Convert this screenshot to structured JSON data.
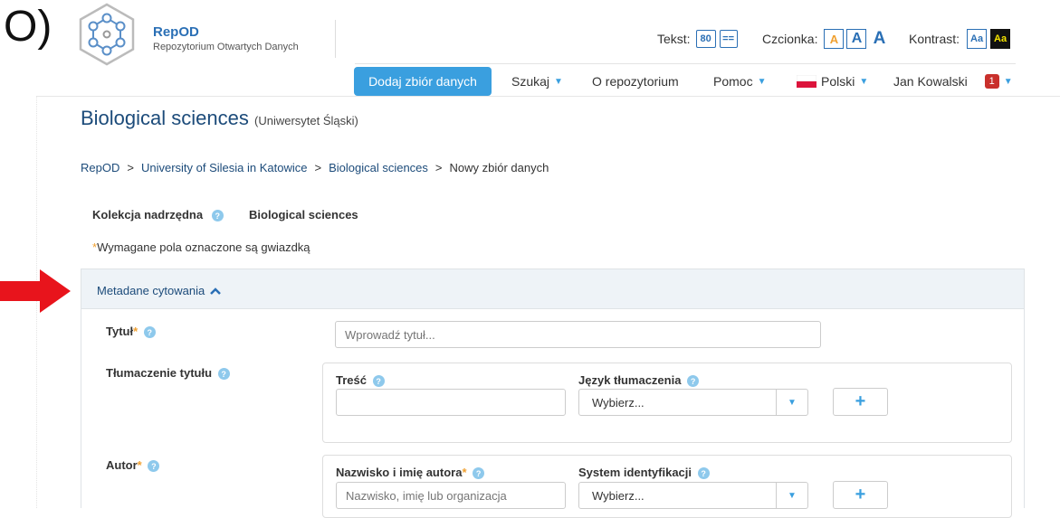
{
  "corner_label": "O)",
  "brand": {
    "name": "RepOD",
    "subtitle": "Repozytorium Otwartych Danych"
  },
  "accessibility": {
    "text_label": "Tekst:",
    "text_size": "80",
    "text_spacing": "==",
    "font_label": "Czcionka:",
    "font_options": [
      "A",
      "A",
      "A"
    ],
    "contrast_label": "Kontrast:",
    "contrast_options": [
      "Aa",
      "Aa"
    ]
  },
  "nav": {
    "add_dataset": "Dodaj zbiór danych",
    "search": "Szukaj",
    "about": "O repozytorium",
    "help": "Pomoc",
    "language": "Polski",
    "user": "Jan Kowalski",
    "notifications": "1"
  },
  "page": {
    "title": "Biological sciences",
    "subtitle": "(Uniwersytet Śląski)"
  },
  "breadcrumb": [
    "RepOD",
    "University of Silesia in Katowice",
    "Biological sciences",
    "Nowy zbiór danych"
  ],
  "breadcrumb_sep": ">",
  "parent_collection": {
    "label": "Kolekcja nadrzędna",
    "value": "Biological sciences"
  },
  "required_note": {
    "star": "*",
    "text": "Wymagane pola oznaczone są gwiazdką"
  },
  "section": {
    "title": "Metadane cytowania"
  },
  "form": {
    "title": {
      "label": "Tytuł",
      "star": "*",
      "placeholder": "Wprowadź tytuł..."
    },
    "title_translation": {
      "label": "Tłumaczenie tytułu",
      "content_label": "Treść",
      "language_label": "Język tłumaczenia",
      "language_value": "Wybierz...",
      "add": "+"
    },
    "author": {
      "label": "Autor",
      "star": "*",
      "name_label": "Nazwisko i imię autora",
      "name_star": "*",
      "name_placeholder": "Nazwisko, imię lub organizacja",
      "id_system_label": "System identyfikacji",
      "id_system_value": "Wybierz...",
      "add": "+"
    }
  },
  "colors": {
    "accent": "#3a9fdf",
    "brand": "#2a6fb5",
    "title": "#1c4b7a",
    "arrow": "#e8141c",
    "required": "#f0a030"
  }
}
